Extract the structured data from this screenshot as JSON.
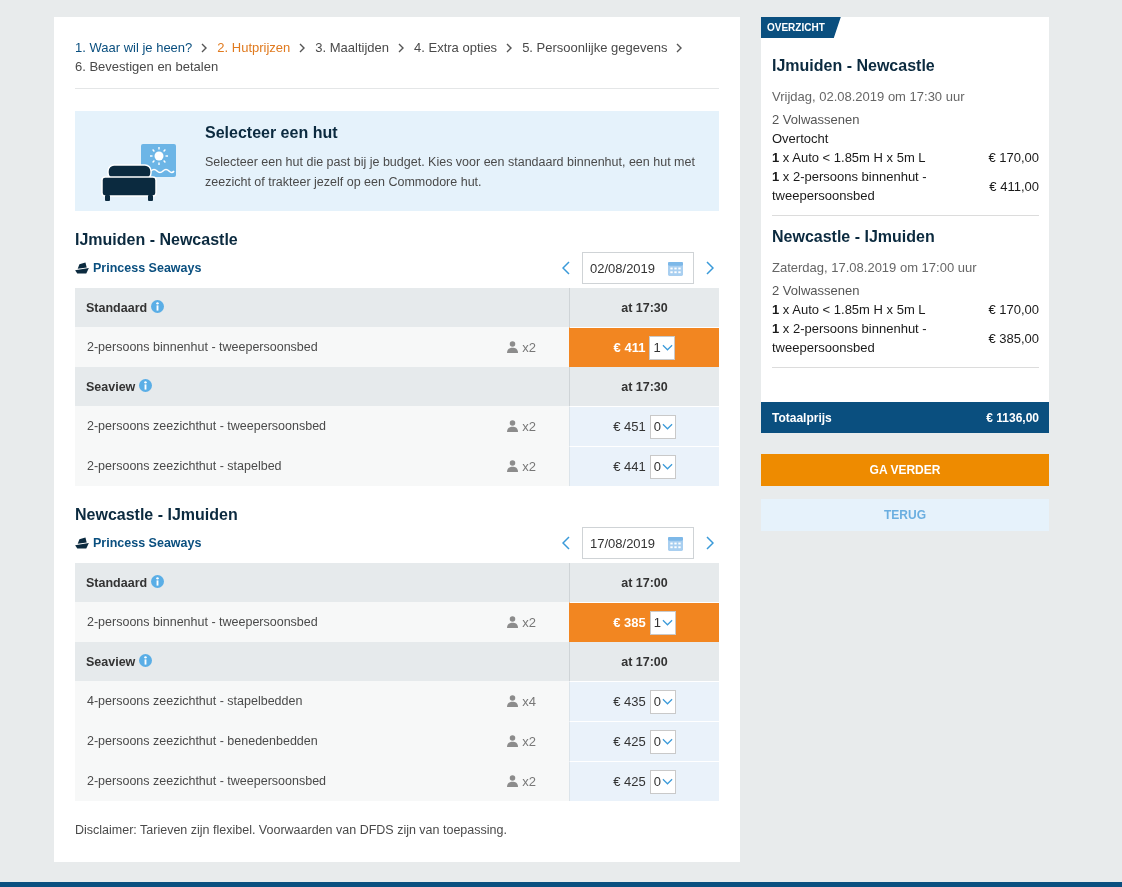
{
  "breadcrumb": [
    {
      "label": "1. Waar wil je heen?",
      "completed": true,
      "selected": false
    },
    {
      "label": "2. Hutprijzen",
      "completed": false,
      "selected": true
    },
    {
      "label": "3. Maaltijden",
      "completed": false,
      "selected": false
    },
    {
      "label": "4. Extra opties",
      "completed": false,
      "selected": false
    },
    {
      "label": "5. Persoonlijke gegevens",
      "completed": false,
      "selected": false
    },
    {
      "label": "6. Bevestigen en betalen",
      "completed": false,
      "selected": false
    }
  ],
  "banner": {
    "title": "Selecteer een hut",
    "text": "Selecteer een hut die past bij je budget. Kies voor een standaard binnenhut, een hut met zeezicht of trakteer jezelf op een Commodore hut."
  },
  "crossings": [
    {
      "title": "IJmuiden - Newcastle",
      "ship": "Princess Seaways",
      "date": "02/08/2019",
      "groups": [
        {
          "name": "Standaard",
          "time": "at 17:30",
          "cabins": [
            {
              "name": "2-persoons binnenhut - tweepersoonsbed",
              "occupancy": "x2",
              "price": "€ 411",
              "quantity": "1",
              "selected": true
            }
          ]
        },
        {
          "name": "Seaview",
          "time": "at 17:30",
          "cabins": [
            {
              "name": "2-persoons zeezichthut - tweepersoonsbed",
              "occupancy": "x2",
              "price": "€ 451",
              "quantity": "0",
              "selected": false
            },
            {
              "name": "2-persoons zeezichthut - stapelbed",
              "occupancy": "x2",
              "price": "€ 441",
              "quantity": "0",
              "selected": false
            }
          ]
        }
      ]
    },
    {
      "title": "Newcastle - IJmuiden",
      "ship": "Princess Seaways",
      "date": "17/08/2019",
      "groups": [
        {
          "name": "Standaard",
          "time": "at 17:00",
          "cabins": [
            {
              "name": "2-persoons binnenhut - tweepersoonsbed",
              "occupancy": "x2",
              "price": "€ 385",
              "quantity": "1",
              "selected": true
            }
          ]
        },
        {
          "name": "Seaview",
          "time": "at 17:00",
          "cabins": [
            {
              "name": "4-persoons zeezichthut - stapelbedden",
              "occupancy": "x4",
              "price": "€ 435",
              "quantity": "0",
              "selected": false
            },
            {
              "name": "2-persoons zeezichthut - benedenbedden",
              "occupancy": "x2",
              "price": "€ 425",
              "quantity": "0",
              "selected": false
            },
            {
              "name": "2-persoons zeezichthut - tweepersoonsbed",
              "occupancy": "x2",
              "price": "€ 425",
              "quantity": "0",
              "selected": false
            }
          ]
        }
      ]
    }
  ],
  "disclaimer": "Disclaimer: Tarieven zijn flexibel. Voorwaarden van DFDS zijn van toepassing.",
  "summary": {
    "tag": "OVERZICHT",
    "legs": [
      {
        "title": "IJmuiden - Newcastle",
        "date": "Vrijdag, 02.08.2019 om 17:30 uur",
        "passengers": "2 Volwassenen",
        "section": "Overtocht",
        "items": [
          {
            "text": "**1** x Auto < 1.85m H x 5m L",
            "price": "€ 170,00"
          },
          {
            "text": "**1** x 2-persoons binnenhut - tweepersoonsbed",
            "price": "€ 411,00"
          }
        ]
      },
      {
        "title": "Newcastle - IJmuiden",
        "date": "Zaterdag, 17.08.2019 om 17:00 uur",
        "passengers": "2 Volwassenen",
        "items": [
          {
            "text": "**1** x Auto < 1.85m H x 5m L",
            "price": "€ 170,00"
          },
          {
            "text": "**1** x 2-persoons binnenhut - tweepersoonsbed",
            "price": "€ 385,00"
          }
        ]
      }
    ],
    "total_label": "Totaalprijs",
    "total": "€ 1136,00"
  },
  "buttons": [
    {
      "label": "GA VERDER",
      "kind": "primary"
    },
    {
      "label": "TERUG",
      "kind": "secondary"
    }
  ]
}
